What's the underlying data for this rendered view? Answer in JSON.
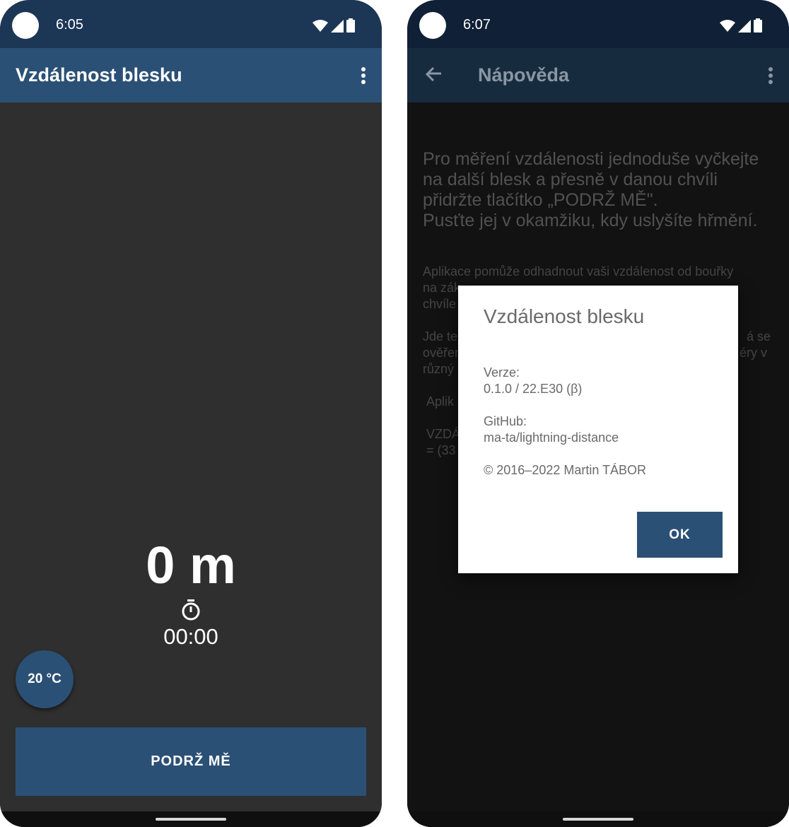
{
  "left_screen": {
    "status_time": "6:05",
    "app_title": "Vzdálenost blesku",
    "distance": "0 m",
    "timer": "00:00",
    "temperature": "20 °C",
    "hold_button_label": "PODRŽ MĚ",
    "icons": {
      "menu": "more-vert-icon",
      "stopwatch": "stopwatch-icon",
      "wifi": "wifi-icon",
      "signal": "signal-icon",
      "battery": "battery-icon"
    }
  },
  "right_screen": {
    "status_time": "6:07",
    "screen_title": "Nápověda",
    "help_lead_lines": [
      "Pro měření vzdálenosti jednoduše vyčkejte",
      "na další blesk a přesně v danou chvíli",
      "přidržte tlačítko „PODRŽ MĚ\".",
      "Pusťte jej v okamžiku, kdy uslyšíte hřmění."
    ],
    "help_small_lines": [
      "Aplikace pomůže odhadnout vaši vzdálenost od bouřky",
      "na zák",
      "chvíle",
      "Jde te",
      "ověřen",
      "různý",
      "Aplik",
      "VZDÁ",
      "= (33"
    ],
    "help_small_right_fragments": [
      "á se",
      "éry v"
    ],
    "dialog": {
      "title": "Vzdálenost blesku",
      "version_label": "Verze:",
      "version_value": "0.1.0 / 22.E30 (β)",
      "github_label": "GitHub:",
      "github_value": "ma-ta/lightning-distance",
      "copyright": "© 2016–2022 Martin TÁBOR",
      "ok_label": "OK"
    },
    "icons": {
      "back": "arrow-back-icon",
      "menu": "more-vert-icon"
    }
  },
  "colors": {
    "status_bar": "#1c3656",
    "app_bar": "#2b5075",
    "background_dark": "#2f2f2f",
    "button": "#2b5075"
  }
}
